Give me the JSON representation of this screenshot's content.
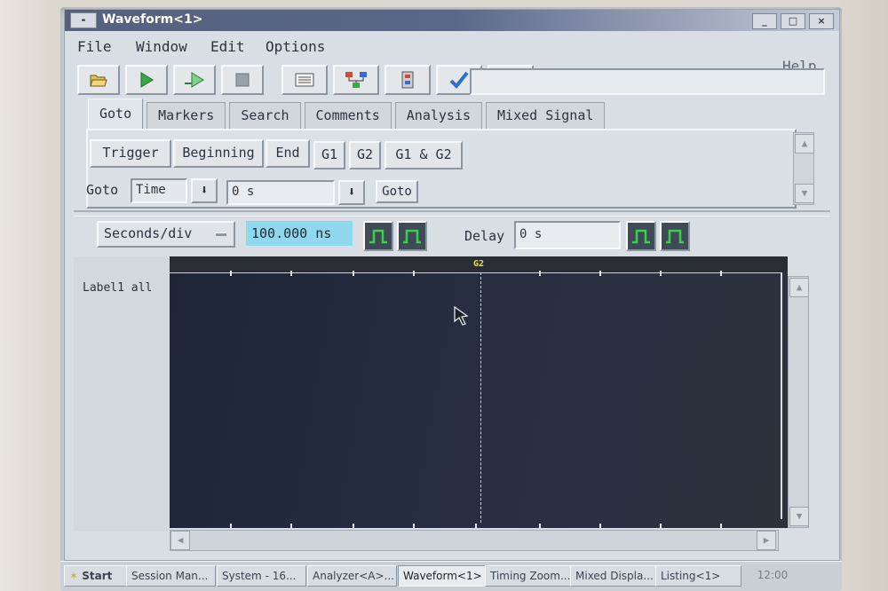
{
  "window": {
    "title": "Waveform<1>",
    "sysmenu": "-",
    "controls": {
      "minimize": "_",
      "maximize": "□",
      "close": "×"
    }
  },
  "menubar": {
    "file": "File",
    "window": "Window",
    "edit": "Edit",
    "options": "Options",
    "help": "Help"
  },
  "toolbar": {
    "icons": [
      "open-folder-icon",
      "run-icon",
      "run-repetitive-icon",
      "stop-icon",
      "listing-icon",
      "overview-icon",
      "config-icon",
      "check-icon",
      "tools-icon"
    ],
    "accent": "#3aa64a"
  },
  "tabs": [
    {
      "label": "Goto",
      "active": true
    },
    {
      "label": "Markers",
      "active": false
    },
    {
      "label": "Search",
      "active": false
    },
    {
      "label": "Comments",
      "active": false
    },
    {
      "label": "Analysis",
      "active": false
    },
    {
      "label": "Mixed Signal",
      "active": false
    }
  ],
  "goto_panel": {
    "trigger": "Trigger",
    "beginning": "Beginning",
    "end": "End",
    "g1": "G1",
    "g2": "G2",
    "g1_g2": "G1 & G2",
    "goto_label": "Goto",
    "mode": "Time",
    "arrow": "⬇",
    "time_value": "0 s",
    "goto_button": "Goto"
  },
  "controls": {
    "scale_label": "Seconds/div",
    "scale_value": "100.000 ns",
    "delay_label": "Delay",
    "delay_value": "0 s",
    "pulse_color": "#39d04a"
  },
  "waveform": {
    "labels": [
      "Label1 all"
    ],
    "marker": "G2",
    "marker_color": "#e0dc4a"
  },
  "taskbar": {
    "start": "Start",
    "items": [
      {
        "label": "Session Man...",
        "active": false
      },
      {
        "label": "System - 16...",
        "active": false
      },
      {
        "label": "Analyzer<A>...",
        "active": false
      },
      {
        "label": "Waveform<1>",
        "active": true
      },
      {
        "label": "Timing Zoom...",
        "active": false
      },
      {
        "label": "Mixed Displa...",
        "active": false
      },
      {
        "label": "Listing<1>",
        "active": false
      }
    ],
    "clock": "12:00"
  }
}
